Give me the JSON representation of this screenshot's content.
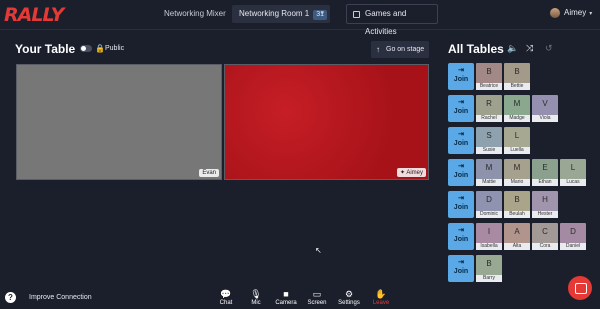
{
  "app": {
    "logo": "RALLY"
  },
  "header": {
    "event_tab": "Networking Mixer",
    "room_tab": "Networking Room 1",
    "room_count": "31",
    "games_button": "Games and Activities",
    "user_name": "Aimey"
  },
  "your_table": {
    "title": "Your Table",
    "privacy_label": "Public",
    "stage_button": "Go on stage",
    "videos": [
      {
        "name": "Evan"
      },
      {
        "name": "Aimey"
      }
    ]
  },
  "all_tables": {
    "title": "All Tables",
    "join_label": "Join",
    "rows": [
      {
        "seats": [
          {
            "initial": "B",
            "name": "Beatrice",
            "color": "#a28987"
          },
          {
            "initial": "B",
            "name": "Bettie",
            "color": "#a49a8a"
          }
        ]
      },
      {
        "seats": [
          {
            "initial": "R",
            "name": "Rachel",
            "color": "#9ea18d"
          },
          {
            "initial": "M",
            "name": "Madge",
            "color": "#8aa88e"
          },
          {
            "initial": "V",
            "name": "Viola",
            "color": "#9590b0"
          }
        ]
      },
      {
        "seats": [
          {
            "initial": "S",
            "name": "Susie",
            "color": "#8ea1ae"
          },
          {
            "initial": "L",
            "name": "Luella",
            "color": "#a7a892"
          }
        ]
      },
      {
        "seats": [
          {
            "initial": "M",
            "name": "Mattie",
            "color": "#8d93ab"
          },
          {
            "initial": "M",
            "name": "Mario",
            "color": "#a6a08f"
          },
          {
            "initial": "E",
            "name": "Ethan",
            "color": "#8ba18e"
          },
          {
            "initial": "L",
            "name": "Lucas",
            "color": "#9aa794"
          }
        ]
      },
      {
        "seats": [
          {
            "initial": "D",
            "name": "Dominic",
            "color": "#8f93b0"
          },
          {
            "initial": "B",
            "name": "Beulah",
            "color": "#aaa58a"
          },
          {
            "initial": "H",
            "name": "Hester",
            "color": "#a095ad"
          }
        ]
      },
      {
        "seats": [
          {
            "initial": "I",
            "name": "Isabella",
            "color": "#a88aa3"
          },
          {
            "initial": "A",
            "name": "Alta",
            "color": "#b1958c"
          },
          {
            "initial": "C",
            "name": "Cora",
            "color": "#a39a98"
          },
          {
            "initial": "D",
            "name": "Daniel",
            "color": "#a48aa2"
          }
        ]
      },
      {
        "seats": [
          {
            "initial": "B",
            "name": "Barry",
            "color": "#98a893"
          }
        ]
      }
    ]
  },
  "footer": {
    "improve": "Improve Connection",
    "controls": [
      {
        "label": "Chat",
        "icon": "chat-icon"
      },
      {
        "label": "Mic",
        "icon": "mic-icon"
      },
      {
        "label": "Camera",
        "icon": "camera-icon"
      },
      {
        "label": "Screen",
        "icon": "screen-icon"
      },
      {
        "label": "Settings",
        "icon": "gear-icon"
      },
      {
        "label": "Leave",
        "icon": "leave-icon"
      }
    ]
  }
}
